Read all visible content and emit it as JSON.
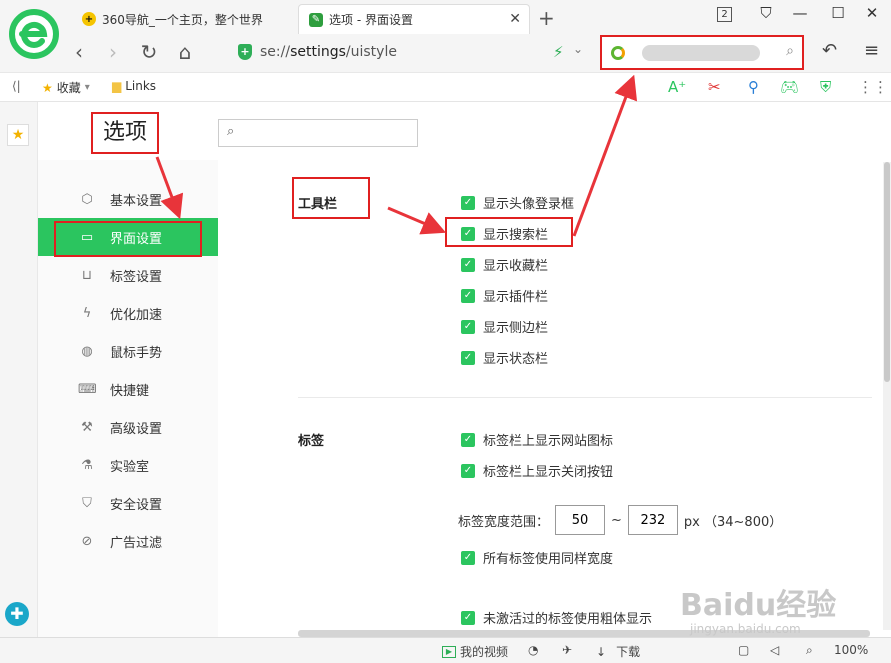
{
  "browser": {
    "tabs": [
      {
        "title": "360导航_一个主页，整个世界",
        "active": false
      },
      {
        "title": "选项 - 界面设置",
        "active": true
      }
    ],
    "tab_count": "2",
    "url_prefix": "se://",
    "url_main": "settings",
    "url_suffix": "/uistyle",
    "bookmarks": [
      {
        "label": "收藏",
        "icon": "star-icon"
      },
      {
        "label": "Links",
        "icon": "folder-icon"
      }
    ]
  },
  "page": {
    "title": "选项",
    "search_placeholder": ""
  },
  "nav": [
    {
      "label": "基本设置",
      "icon": "gear-icon",
      "active": false
    },
    {
      "label": "界面设置",
      "icon": "window-icon",
      "active": true
    },
    {
      "label": "标签设置",
      "icon": "tab-icon",
      "active": false
    },
    {
      "label": "优化加速",
      "icon": "bolt-icon",
      "active": false
    },
    {
      "label": "鼠标手势",
      "icon": "mouse-icon",
      "active": false
    },
    {
      "label": "快捷键",
      "icon": "keyboard-icon",
      "active": false
    },
    {
      "label": "高级设置",
      "icon": "wrench-icon",
      "active": false
    },
    {
      "label": "实验室",
      "icon": "flask-icon",
      "active": false
    },
    {
      "label": "安全设置",
      "icon": "shield-icon",
      "active": false
    },
    {
      "label": "广告过滤",
      "icon": "block-icon",
      "active": false
    }
  ],
  "sections": {
    "toolbar": {
      "title": "工具栏",
      "options": [
        {
          "label": "显示头像登录框",
          "checked": true
        },
        {
          "label": "显示搜索栏",
          "checked": true
        },
        {
          "label": "显示收藏栏",
          "checked": true
        },
        {
          "label": "显示插件栏",
          "checked": true
        },
        {
          "label": "显示侧边栏",
          "checked": true
        },
        {
          "label": "显示状态栏",
          "checked": true
        }
      ]
    },
    "tabs": {
      "title": "标签",
      "options": [
        {
          "label": "标签栏上显示网站图标",
          "checked": true
        },
        {
          "label": "标签栏上显示关闭按钮",
          "checked": true
        }
      ],
      "width_label": "标签宽度范围：",
      "width_min": "50",
      "width_sep": "~",
      "width_max": "232",
      "width_unit": "px （34~800）",
      "same_width": {
        "label": "所有标签使用同样宽度",
        "checked": true
      },
      "bold_inactive": {
        "label": "未激活过的标签使用粗体显示",
        "checked": true
      }
    }
  },
  "statusbar": {
    "video": "我的视频",
    "download": "下载",
    "zoom": "100%"
  },
  "watermark": {
    "main": "Baidu经验",
    "sub": "jingyan.baidu.com"
  },
  "colors": {
    "accent": "#2bc55f",
    "annotation": "#e02020"
  }
}
